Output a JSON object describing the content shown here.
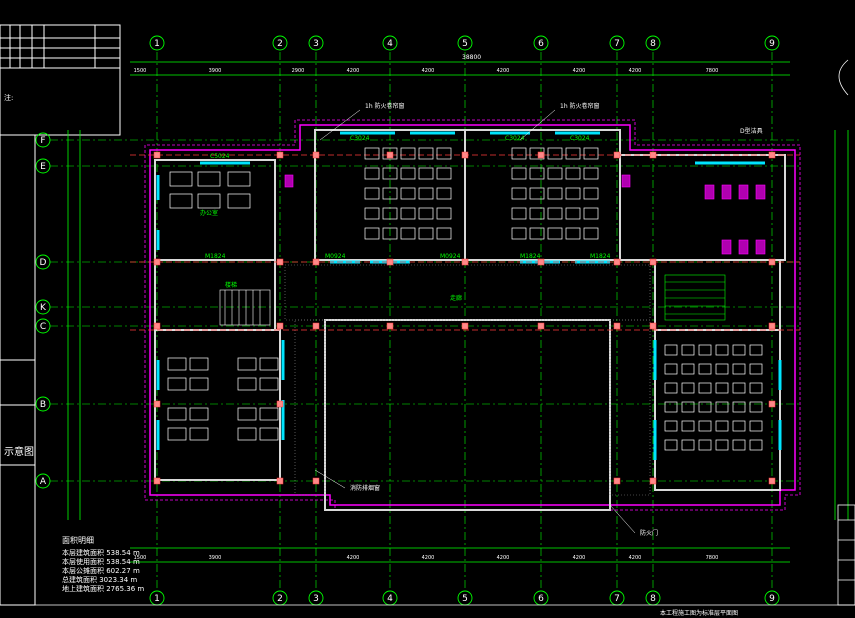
{
  "grid": {
    "columns": [
      "1",
      "2",
      "3",
      "4",
      "5",
      "6",
      "7",
      "8",
      "9"
    ],
    "columns_bottom": [
      "1",
      "2",
      "3",
      "4",
      "5",
      "6",
      "7",
      "8",
      "9"
    ],
    "rows": [
      "F",
      "E",
      "D",
      "K",
      "C",
      "B",
      "A"
    ]
  },
  "dimensions": {
    "top_row": [
      "1500",
      "3900",
      "2900",
      "4200",
      "4200",
      "4200",
      "4200",
      "4200",
      "7800"
    ],
    "overall": "38800",
    "bottom_row": [
      "1500",
      "3900",
      "4200",
      "4200",
      "4200",
      "4200",
      "4200",
      "7800"
    ]
  },
  "room_labels": {
    "classroom_a": "C3024",
    "classroom_b": "C3024",
    "window_e": "C5024",
    "window_e2": "C3024",
    "door_1": "M0924",
    "door_2": "M0924",
    "door_3": "M1824",
    "door_4": "M1824",
    "door_5": "M1824",
    "stair": "楼梯",
    "office": "办公室",
    "corridor": "走廊"
  },
  "notes": {
    "top_note_1": "1h 防火卷帘窗",
    "top_note_2": "1h 防火卷帘窗",
    "bottom_note_1": "消防排烟窗",
    "bottom_note_2": "防火门",
    "right_note": "D型洁具"
  },
  "area_summary": {
    "title": "面积明细",
    "lines": [
      "本层建筑面积 538.54 m",
      "本层使用面积 538.54 m",
      "本层公摊面积 602.27 m",
      "总建筑面积 3023.34 m",
      "地上建筑面积 2765.36 m"
    ]
  },
  "left_panel": {
    "sheet_label": "示意图",
    "note": "注:"
  },
  "bottom_strip": "本工程施工图为标准层平面图"
}
